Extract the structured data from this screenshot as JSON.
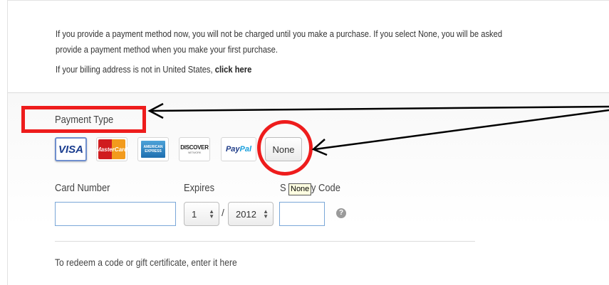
{
  "info": {
    "line1": "If you provide a payment method now, you will not be charged until you make a purchase. If you select None, you will be asked",
    "line2": "provide a payment method when you make your first purchase.",
    "line3_prefix": "If your billing address is not in United States,",
    "line3_link": "click here"
  },
  "payment": {
    "type_label": "Payment Type",
    "cards": {
      "visa": "VISA",
      "mastercard": "MasterCard",
      "amex": "AMERICAN EXPRESS",
      "discover": "DISCOVER",
      "discover_sub": "NETWORK",
      "paypal_pay": "Pay",
      "paypal_pal": "Pal"
    },
    "none_button": "None"
  },
  "card_form": {
    "card_number_label": "Card Number",
    "expires_label": "Expires",
    "security_code_label_start": "S",
    "security_code_label_end": "ty Code",
    "card_number_value": "",
    "month_value": "1",
    "separator": "/",
    "year_value": "2012",
    "security_code_value": "",
    "help_icon_glyph": "?"
  },
  "tooltip": {
    "text": "None"
  },
  "redeem": {
    "text": "To redeem a code or gift certificate, enter it here"
  },
  "annotations": {
    "color": "#ee1c1c",
    "arrow_color": "#000000"
  },
  "icons": [
    "credit-card-visa-icon",
    "credit-card-mastercard-icon",
    "credit-card-amex-icon",
    "credit-card-discover-icon",
    "paypal-icon",
    "help-icon",
    "select-arrows-icon"
  ]
}
